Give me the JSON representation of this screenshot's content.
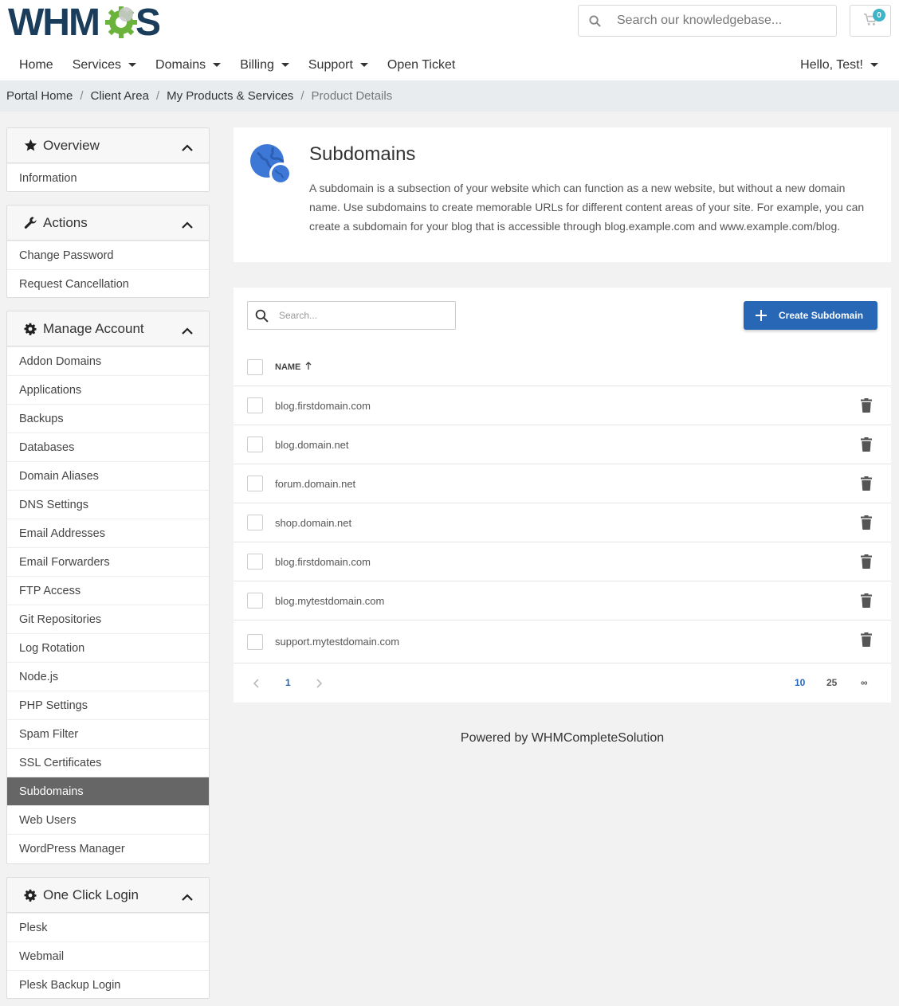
{
  "header": {
    "logo_text": "WHMCS",
    "search_placeholder": "Search our knowledgebase...",
    "cart_count": "0"
  },
  "nav": {
    "items": [
      {
        "label": "Home",
        "dropdown": false
      },
      {
        "label": "Services",
        "dropdown": true
      },
      {
        "label": "Domains",
        "dropdown": true
      },
      {
        "label": "Billing",
        "dropdown": true
      },
      {
        "label": "Support",
        "dropdown": true
      },
      {
        "label": "Open Ticket",
        "dropdown": false
      }
    ],
    "user": "Hello, Test!"
  },
  "breadcrumb": [
    "Portal Home",
    "Client Area",
    "My Products & Services",
    "Product Details"
  ],
  "sidebar": {
    "overview": {
      "title": "Overview",
      "items": [
        "Information"
      ]
    },
    "actions": {
      "title": "Actions",
      "items": [
        "Change Password",
        "Request Cancellation"
      ]
    },
    "manage": {
      "title": "Manage Account",
      "items": [
        "Addon Domains",
        "Applications",
        "Backups",
        "Databases",
        "Domain Aliases",
        "DNS Settings",
        "Email Addresses",
        "Email Forwarders",
        "FTP Access",
        "Git Repositories",
        "Log Rotation",
        "Node.js",
        "PHP Settings",
        "Spam Filter",
        "SSL Certificates",
        "Subdomains",
        "Web Users",
        "WordPress Manager"
      ],
      "active": "Subdomains"
    },
    "oneclick": {
      "title": "One Click Login",
      "items": [
        "Plesk",
        "Webmail",
        "Plesk Backup Login"
      ]
    }
  },
  "main": {
    "title": "Subdomains",
    "description": "A subdomain is a subsection of your website which can function as a new website, but without a new domain name. Use subdomains to create memorable URLs for different content areas of your site. For example, you can create a subdomain for your blog that is accessible through blog.example.com and www.example.com/blog.",
    "table": {
      "search_placeholder": "Search...",
      "create_label": "Create Subdomain",
      "column_name": "NAME",
      "rows": [
        "blog.firstdomain.com",
        "blog.domain.net",
        "forum.domain.net",
        "shop.domain.net",
        "blog.firstdomain.com",
        "blog.mytestdomain.com",
        "support.mytestdomain.com"
      ],
      "pager": {
        "current_page": "1",
        "per_page_options": [
          "10",
          "25",
          "∞"
        ],
        "selected_per_page": "10"
      }
    }
  },
  "footer": {
    "powered": "Powered by WHMCompleteSolution"
  },
  "colors": {
    "primary": "#2767b5",
    "active_sidebar": "#666666",
    "logo_green": "#6cb33e",
    "logo_navy": "#1a3d5c",
    "badge": "#3fb4c7"
  }
}
